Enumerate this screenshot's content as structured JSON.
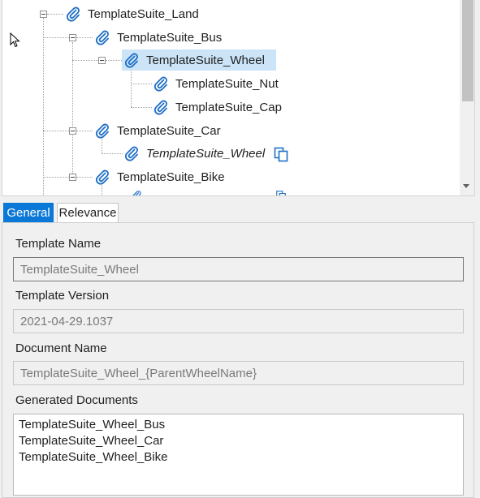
{
  "colors": {
    "accent": "#0a78d7",
    "selection": "#cce4f7",
    "clip_icon": "#1f6fc5"
  },
  "tree": {
    "nodes": [
      {
        "label": "TemplateSuite_Land",
        "icon": "paperclip-icon",
        "expanded": true
      },
      {
        "label": "TemplateSuite_Bus",
        "icon": "paperclip-icon",
        "expanded": true
      },
      {
        "label": "TemplateSuite_Wheel",
        "icon": "paperclip-icon",
        "expanded": true,
        "selected": true
      },
      {
        "label": "TemplateSuite_Nut",
        "icon": "paperclip-icon"
      },
      {
        "label": "TemplateSuite_Cap",
        "icon": "paperclip-icon"
      },
      {
        "label": "TemplateSuite_Car",
        "icon": "paperclip-icon",
        "expanded": true
      },
      {
        "label": "TemplateSuite_Wheel",
        "icon": "paperclip-icon",
        "italic": true,
        "trailing_icon": "copy-link-icon"
      },
      {
        "label": "TemplateSuite_Bike",
        "icon": "paperclip-icon",
        "expanded": true
      }
    ]
  },
  "tabs": [
    {
      "label": "General",
      "active": true
    },
    {
      "label": "Relevance",
      "active": false
    }
  ],
  "form": {
    "template_name": {
      "label": "Template Name",
      "value": "TemplateSuite_Wheel"
    },
    "template_version": {
      "label": "Template Version",
      "value": "2021-04-29.1037"
    },
    "document_name": {
      "label": "Document Name",
      "value": "TemplateSuite_Wheel_{ParentWheelName}"
    },
    "generated_documents": {
      "label": "Generated Documents",
      "items": [
        "TemplateSuite_Wheel_Bus",
        "TemplateSuite_Wheel_Car",
        "TemplateSuite_Wheel_Bike"
      ]
    }
  }
}
